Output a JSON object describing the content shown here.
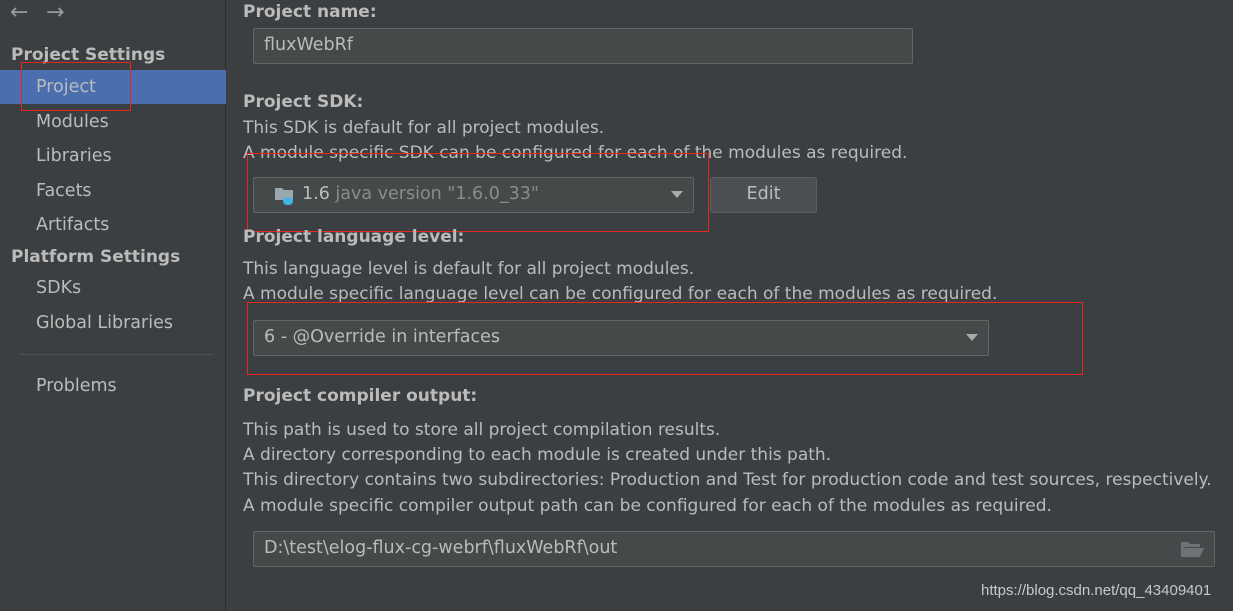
{
  "nav": {
    "back": "←",
    "forward": "→"
  },
  "sidebar": {
    "project_settings": "Project Settings",
    "project_items": [
      {
        "label": "Project",
        "selected": true
      },
      {
        "label": "Modules"
      },
      {
        "label": "Libraries"
      },
      {
        "label": "Facets"
      },
      {
        "label": "Artifacts"
      }
    ],
    "platform_settings": "Platform Settings",
    "platform_items": [
      {
        "label": "SDKs"
      },
      {
        "label": "Global Libraries"
      }
    ],
    "problems": "Problems"
  },
  "main": {
    "name_label": "Project name:",
    "name_value": "fluxWebRf",
    "sdk_label": "Project SDK:",
    "sdk_desc1": "This SDK is default for all project modules.",
    "sdk_desc2": "A module specific SDK can be configured for each of the modules as required.",
    "sdk_version": "1.6",
    "sdk_detail": "java version \"1.6.0_33\"",
    "edit_button": "Edit",
    "lang_label": "Project language level:",
    "lang_desc1": "This language level is default for all project modules.",
    "lang_desc2": "A module specific language level can be configured for each of the modules as required.",
    "lang_value": "6 - @Override in interfaces",
    "out_label": "Project compiler output:",
    "out_desc": [
      "This path is used to store all project compilation results.",
      "A directory corresponding to each module is created under this path.",
      "This directory contains two subdirectories: Production and Test for production code and test sources, respectively.",
      "A module specific compiler output path can be configured for each of the modules as required."
    ],
    "out_value": "D:\\test\\elog-flux-cg-webrf\\fluxWebRf\\out"
  },
  "watermark": "https://blog.csdn.net/qq_43409401",
  "colors": {
    "selection": "#4b6eaf",
    "highlight": "#e8261c"
  }
}
